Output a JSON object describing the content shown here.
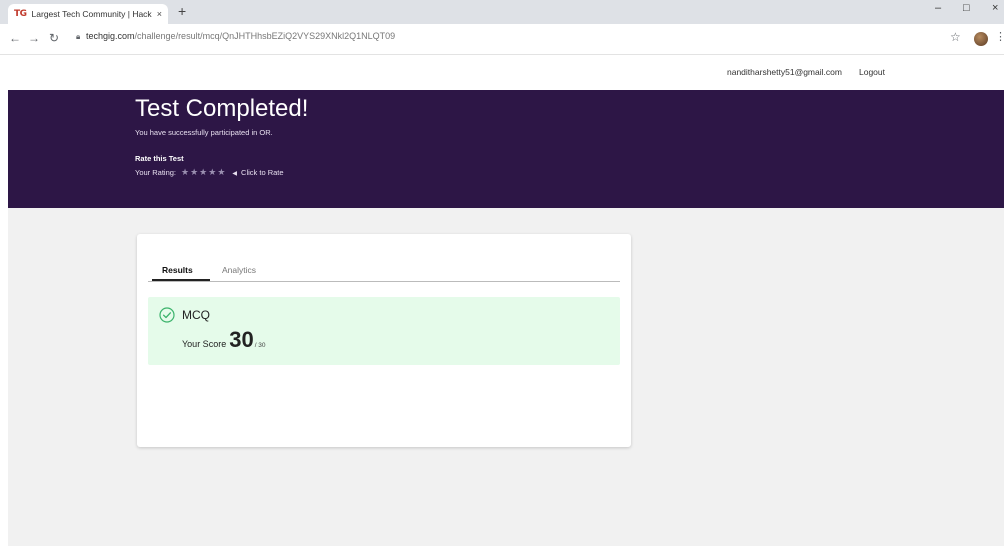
{
  "browser": {
    "tab_favicon": "TG",
    "tab_title": "Largest Tech Community | Hacka",
    "tab_close": "×",
    "new_tab": "+",
    "url_host": "techgig.com",
    "url_path": "/challenge/result/mcq/QnJHTHhsbEZiQ2VYS29XNkl2Q1NLQT09",
    "window_controls": {
      "minimize": "–",
      "maximize": "□",
      "close": "×"
    },
    "icons": [
      "back-icon",
      "forward-icon",
      "reload-icon",
      "lock-icon",
      "bookmark-star-icon",
      "profile-avatar",
      "menu-kebab-icon"
    ]
  },
  "header": {
    "user_email": "nanditharshetty51@gmail.com",
    "logout_label": "Logout"
  },
  "banner": {
    "title": "Test Completed!",
    "subtitle": "You have successfully participated in OR.",
    "rate_heading": "Rate this Test",
    "rating_label": "Your Rating:",
    "stars": [
      1,
      2,
      3,
      4,
      5
    ],
    "click_to_rate": "Click to Rate",
    "background_color": "#2d1646"
  },
  "results_card": {
    "tabs": [
      {
        "label": "Results",
        "active": true
      },
      {
        "label": "Analytics",
        "active": false
      }
    ],
    "section_label": "MCQ",
    "score_label": "Your Score",
    "score_value": "30",
    "score_total": "/ 30",
    "success_color": "#3bb36b",
    "box_color": "#e5fbea"
  }
}
